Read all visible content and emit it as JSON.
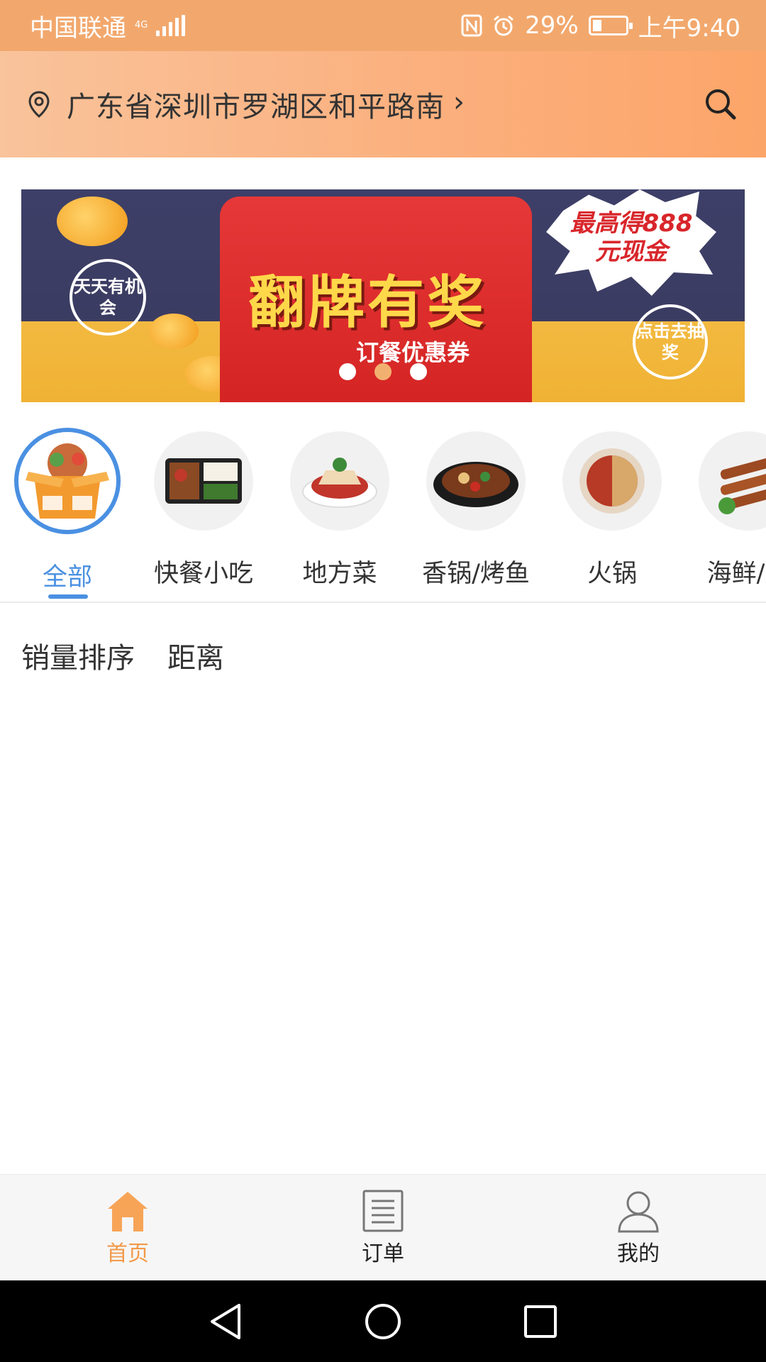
{
  "status_bar": {
    "carrier": "中国联通",
    "network": "4G",
    "battery_percent": "29%",
    "time": "上午9:40"
  },
  "header": {
    "address": "广东省深圳市罗湖区和平路南",
    "location_icon": "location-pin-icon",
    "search_icon": "search-icon"
  },
  "banner": {
    "badge_left": "天天有机会",
    "title": "翻牌有奖",
    "subtitle": "订餐优惠券",
    "burst_text": "最高得888元现金",
    "badge_right": "点击去抽奖",
    "slides_count": 3,
    "active_slide": 2
  },
  "categories": {
    "items": [
      {
        "label": "全部",
        "icon": "all-food-box-icon",
        "active": true
      },
      {
        "label": "快餐小吃",
        "icon": "bento-box-icon",
        "active": false
      },
      {
        "label": "地方菜",
        "icon": "local-dish-icon",
        "active": false
      },
      {
        "label": "香锅/烤鱼",
        "icon": "spicy-pot-icon",
        "active": false
      },
      {
        "label": "火锅",
        "icon": "hotpot-icon",
        "active": false
      },
      {
        "label": "海鲜/烧",
        "icon": "skewer-icon",
        "active": false
      }
    ]
  },
  "sort": {
    "by_sales": "销量排序",
    "by_distance": "距离"
  },
  "bottom_nav": {
    "home": "首页",
    "orders": "订单",
    "mine": "我的"
  },
  "colors": {
    "accent": "#f29a4a",
    "active_category": "#4a90e2",
    "header_gradient_start": "#f9c39b",
    "header_gradient_end": "#fca569"
  }
}
